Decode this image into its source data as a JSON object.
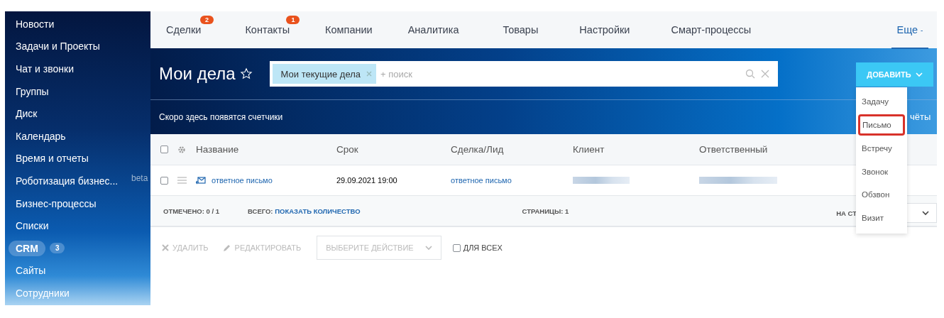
{
  "sidebar": {
    "items": [
      {
        "label": "Новости",
        "selected": false
      },
      {
        "label": "Задачи и Проекты",
        "selected": false
      },
      {
        "label": "Чат и звонки",
        "selected": false
      },
      {
        "label": "Группы",
        "selected": false
      },
      {
        "label": "Диск",
        "selected": false
      },
      {
        "label": "Календарь",
        "selected": false
      },
      {
        "label": "Время и отчеты",
        "selected": false
      },
      {
        "label": "Роботизация бизнес...",
        "selected": false,
        "tag": "beta"
      },
      {
        "label": "Бизнес-процессы",
        "selected": false
      },
      {
        "label": "Списки",
        "selected": false
      },
      {
        "label": "CRM",
        "selected": true,
        "badge": "3"
      },
      {
        "label": "Сайты",
        "selected": false
      },
      {
        "label": "Сотрудники",
        "selected": false
      }
    ]
  },
  "tabs": [
    {
      "label": "Сделки",
      "selected": false,
      "badge": "2"
    },
    {
      "label": "Контакты",
      "selected": false,
      "badge": "1"
    },
    {
      "label": "Компании",
      "selected": false
    },
    {
      "label": "Аналитика",
      "selected": false
    },
    {
      "label": "Товары",
      "selected": false
    },
    {
      "label": "Настройки",
      "selected": false
    },
    {
      "label": "Смарт-процессы",
      "selected": false
    },
    {
      "label": "Еще",
      "selected": true,
      "dropdown": "-"
    }
  ],
  "header": {
    "title": "Мои дела",
    "search": {
      "chip": "Мои текущие дела",
      "placeholder": "+ поиск"
    },
    "add_button": "ДОБАВИТЬ"
  },
  "counters": {
    "text": "Скоро здесь появятся счетчики",
    "right_fragments": [
      "чёты"
    ]
  },
  "table": {
    "select_all_checked": false,
    "columns": [
      "Название",
      "Срок",
      "Сделка/Лид",
      "Клиент",
      "Ответственный"
    ],
    "rows": [
      {
        "checked": false,
        "title": "ответное письмо",
        "deadline": "29.09.2021 19:00",
        "deal": "ответное письмо"
      }
    ]
  },
  "footer": {
    "checked_label": "ОТМЕЧЕНО:",
    "checked_value": "0 / 1",
    "total_label": "ВСЕГО:",
    "total_link": "ПОКАЗАТЬ КОЛИЧЕСТВО",
    "pages_label": "СТРАНИЦЫ:",
    "pages_value": "1",
    "per_page_label": "НА СТ"
  },
  "actions": {
    "delete": "УДАЛИТЬ",
    "edit": "РЕДАКТИРОВАТЬ",
    "select": "ВЫБЕРИТЕ ДЕЙСТВИЕ",
    "for_all": "ДЛЯ ВСЕХ",
    "for_all_checked": false
  },
  "add_menu": {
    "items": [
      {
        "label": "Задачу",
        "highlighted": false
      },
      {
        "label": "Письмо",
        "highlighted": true
      },
      {
        "label": "Встречу",
        "highlighted": false
      },
      {
        "label": "Звонок",
        "highlighted": false
      },
      {
        "label": "Обзвон",
        "highlighted": false
      },
      {
        "label": "Визит",
        "highlighted": false
      }
    ]
  }
}
